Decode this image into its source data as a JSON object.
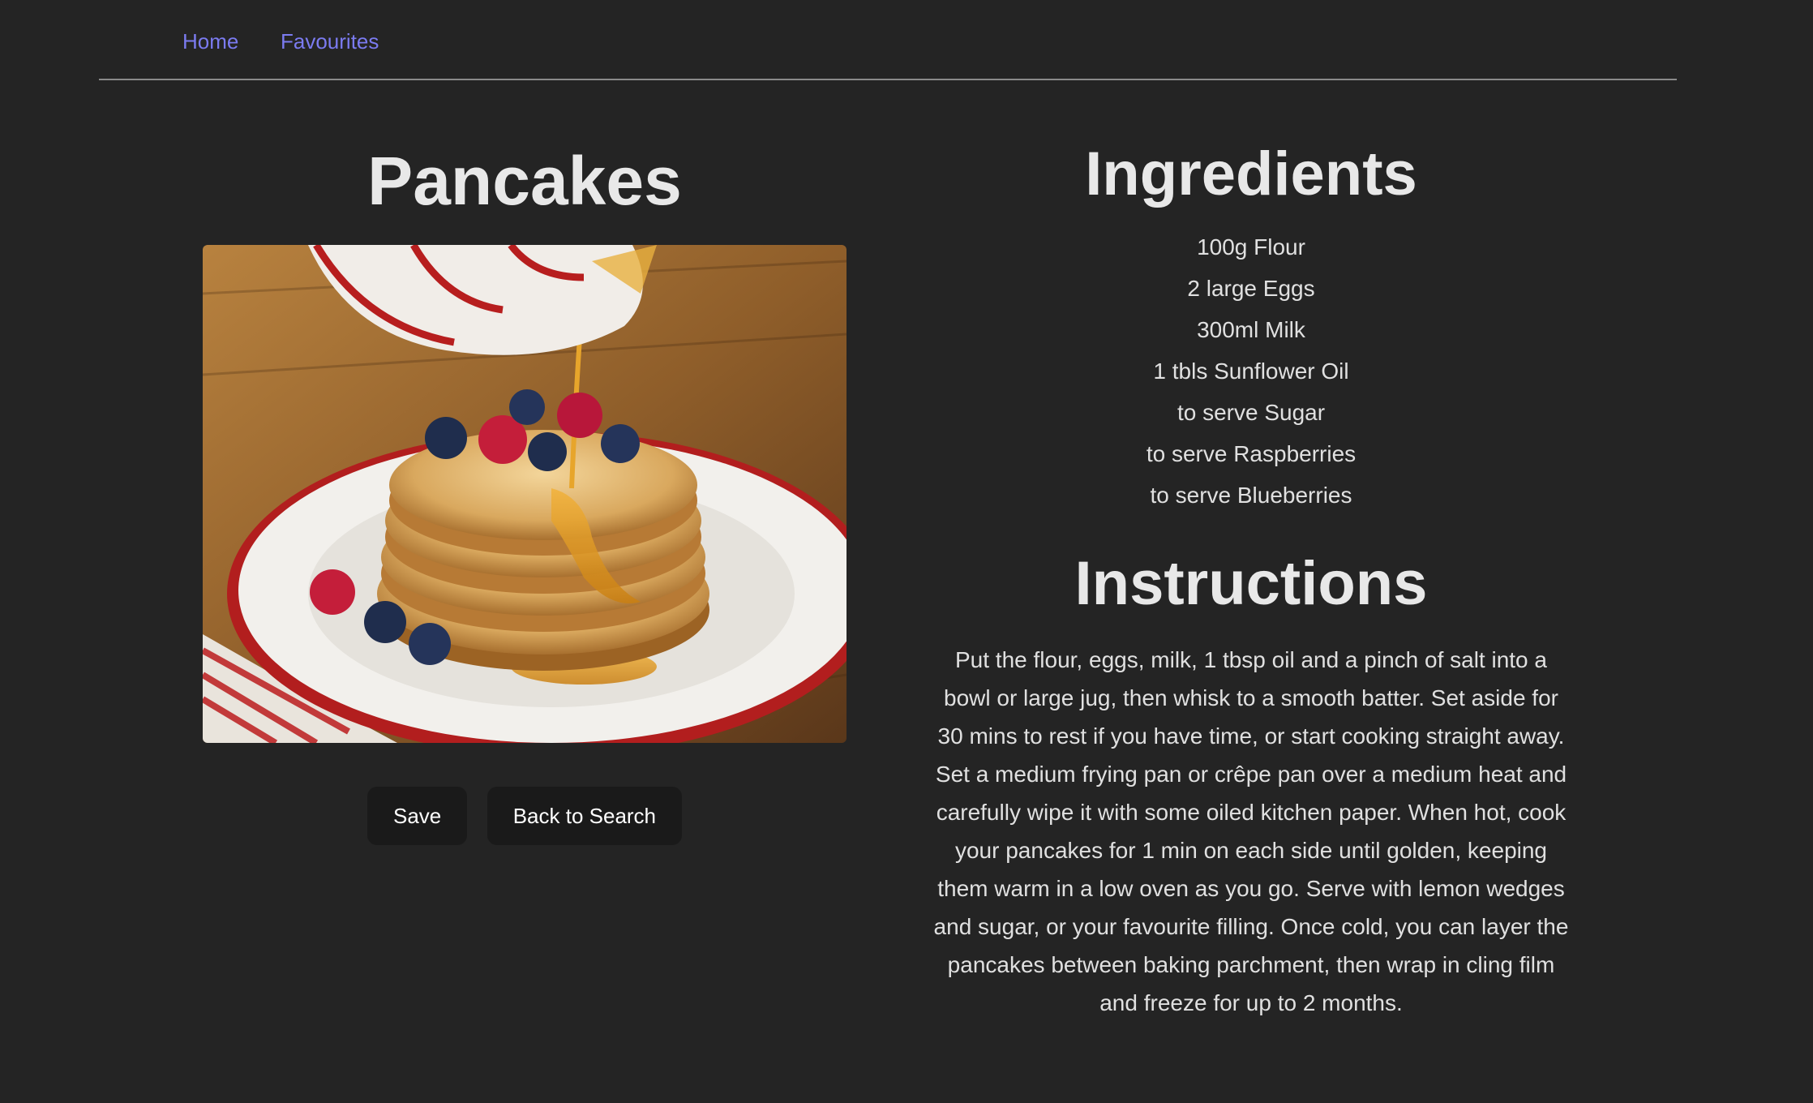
{
  "nav": {
    "home": "Home",
    "favourites": "Favourites"
  },
  "recipe": {
    "title": "Pancakes",
    "image": "pancakes-photo",
    "save_label": "Save",
    "back_label": "Back to Search"
  },
  "ingredients": {
    "title": "Ingredients",
    "items": [
      "100g Flour",
      "2 large Eggs",
      "300ml Milk",
      "1 tbls Sunflower Oil",
      "to serve Sugar",
      "to serve Raspberries",
      "to serve Blueberries"
    ]
  },
  "instructions": {
    "title": "Instructions",
    "text": "Put the flour, eggs, milk, 1 tbsp oil and a pinch of salt into a bowl or large jug, then whisk to a smooth batter. Set aside for 30 mins to rest if you have time, or start cooking straight away. Set a medium frying pan or crêpe pan over a medium heat and carefully wipe it with some oiled kitchen paper. When hot, cook your pancakes for 1 min on each side until golden, keeping them warm in a low oven as you go. Serve with lemon wedges and sugar, or your favourite filling. Once cold, you can layer the pancakes between baking parchment, then wrap in cling film and freeze for up to 2 months."
  },
  "colors": {
    "background": "#242424",
    "link": "#7b7bf0",
    "button": "#1a1a1a"
  }
}
